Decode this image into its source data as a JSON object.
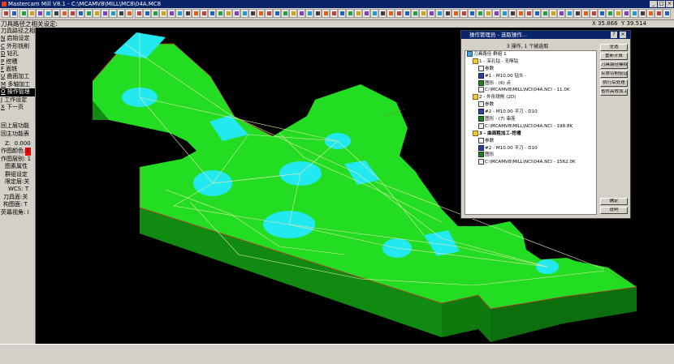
{
  "window": {
    "title": "Mastercam Mill V8.1 - C:\\MCAMV8\\MILL\\MC8\\04A.MC8"
  },
  "coords": {
    "x": "X 35.866",
    "y": "Y 39.514"
  },
  "prompt": "刀具路径之相关设定:",
  "menu": {
    "items": [
      {
        "key": "P",
        "label": "刀具路径之相关设定:"
      },
      {
        "key": "N",
        "label": "启始设定"
      },
      {
        "key": "C",
        "label": "外形铣削"
      },
      {
        "key": "D",
        "label": "钻孔"
      },
      {
        "key": "P",
        "label": "挖槽"
      },
      {
        "key": "F",
        "label": "面铣"
      },
      {
        "key": "U",
        "label": "曲面加工"
      },
      {
        "key": "M",
        "label": "多轴加工"
      },
      {
        "key": "O",
        "label": "操作管理"
      },
      {
        "key": "J",
        "label": "工作设定"
      },
      {
        "key": "X",
        "label": "下一页"
      }
    ],
    "lower": [
      "回上层功能",
      "回主功能表"
    ],
    "z_label": "Z:",
    "z_value": "0.000",
    "props": [
      {
        "label": "作图颜色:",
        "value": "1"
      },
      {
        "label": "作图层别:",
        "value": "1"
      },
      {
        "label": "图素属性",
        "value": ""
      },
      {
        "label": "群组设定",
        "value": ""
      },
      {
        "label": "限定层:关",
        "value": ""
      },
      {
        "label": "WCS:",
        "value": "T"
      },
      {
        "label": "刀具面:关",
        "value": ""
      },
      {
        "label": "构图面:",
        "value": "T"
      },
      {
        "label": "荧幕视角:",
        "value": "I"
      }
    ]
  },
  "dialog": {
    "title": "操作管理员 - 选取操作...",
    "subtitle": "3 操作, 1 个被选取",
    "tree": [
      {
        "indent": 0,
        "icon": "op",
        "text": "刀具路径 群组 1",
        "bold": false
      },
      {
        "indent": 1,
        "icon": "folder",
        "text": "1 - 深孔钻 - 无啄钻",
        "bold": false
      },
      {
        "indent": 2,
        "icon": "file",
        "text": "参数",
        "bold": false
      },
      {
        "indent": 2,
        "icon": "tool",
        "text": "#1 - M10.00 钻头 -",
        "bold": false
      },
      {
        "indent": 2,
        "icon": "geo",
        "text": "图形 - (6) 点",
        "bold": false
      },
      {
        "indent": 2,
        "icon": "file",
        "text": "C:\\MCAMV8\\MILL\\NCI\\04A.NCI - 11.0K",
        "bold": false
      },
      {
        "indent": 1,
        "icon": "folder",
        "text": "2 - 外形铣削 (2D)",
        "bold": false
      },
      {
        "indent": 2,
        "icon": "file",
        "text": "参数",
        "bold": false
      },
      {
        "indent": 2,
        "icon": "tool",
        "text": "#2 - M10.00 平刀 - D10",
        "bold": false
      },
      {
        "indent": 2,
        "icon": "geo",
        "text": "图形 - (7) 串连",
        "bold": false
      },
      {
        "indent": 2,
        "icon": "file",
        "text": "C:\\MCAMV8\\MILL\\NCI\\04A.NCI - 198.8K",
        "bold": false
      },
      {
        "indent": 1,
        "icon": "folder",
        "text": "3 - 曲面粗加工-挖槽",
        "bold": true
      },
      {
        "indent": 2,
        "icon": "file",
        "text": "参数",
        "bold": false
      },
      {
        "indent": 2,
        "icon": "tool",
        "text": "#2 - M10.00 平刀 - D10",
        "bold": false
      },
      {
        "indent": 2,
        "icon": "geo",
        "text": "图形",
        "bold": false
      },
      {
        "indent": 2,
        "icon": "file",
        "text": "C:\\MCAMV8\\MILL\\NCI\\04A.NCI - 1562.0K",
        "bold": false
      }
    ],
    "buttons": [
      "全选",
      "重新计算",
      "刀具路径模拟",
      "实体切削验证",
      "执行后处理",
      "省时高效加工"
    ],
    "ok": "确定",
    "help": "说明"
  },
  "colors": {
    "part": "#22dd22",
    "part_side": "#118a11",
    "pocket": "#22e8f0",
    "toolpath": "#e8e8b0",
    "background": "#000000"
  }
}
